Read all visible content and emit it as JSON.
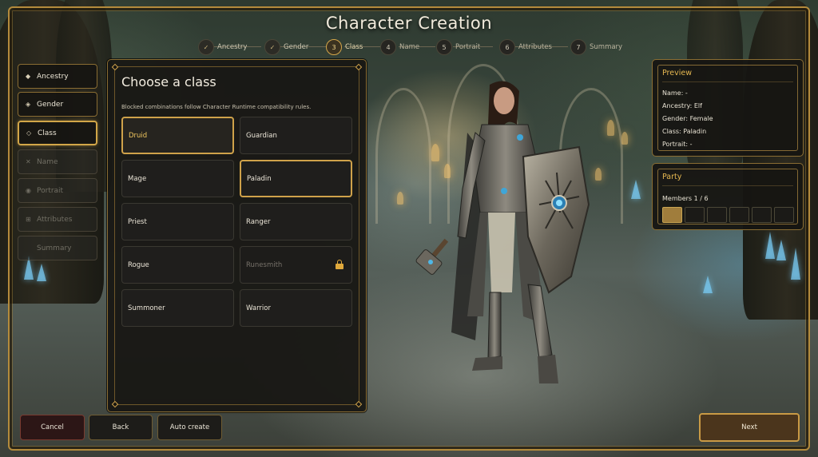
{
  "title": "Character Creation",
  "stepper": [
    {
      "num": "✓",
      "label": "Ancestry",
      "state": "done"
    },
    {
      "num": "✓",
      "label": "Gender",
      "state": "done"
    },
    {
      "num": "3",
      "label": "Class",
      "state": "current"
    },
    {
      "num": "4",
      "label": "Name",
      "state": "pending"
    },
    {
      "num": "5",
      "label": "Portrait",
      "state": "pending"
    },
    {
      "num": "6",
      "label": "Attributes",
      "state": "pending"
    },
    {
      "num": "7",
      "label": "Summary",
      "state": "pending"
    }
  ],
  "sidebar": {
    "items": [
      {
        "label": "Ancestry",
        "icon": "◆",
        "state": "done"
      },
      {
        "label": "Gender",
        "icon": "◈",
        "state": "done"
      },
      {
        "label": "Class",
        "icon": "◇",
        "state": "active"
      },
      {
        "label": "Name",
        "icon": "✕",
        "state": "locked"
      },
      {
        "label": "Portrait",
        "icon": "◉",
        "state": "locked"
      },
      {
        "label": "Attributes",
        "icon": "⊞",
        "state": "locked"
      },
      {
        "label": "Summary",
        "icon": "",
        "state": "locked"
      }
    ]
  },
  "class_panel": {
    "title": "Choose a class",
    "subtitle": "Blocked combinations follow Character Runtime compatibility rules.",
    "classes": [
      {
        "label": "Druid",
        "state": "selected"
      },
      {
        "label": "Guardian",
        "state": "normal"
      },
      {
        "label": "Mage",
        "state": "normal"
      },
      {
        "label": "Paladin",
        "state": "chosen"
      },
      {
        "label": "Priest",
        "state": "normal"
      },
      {
        "label": "Ranger",
        "state": "normal"
      },
      {
        "label": "Rogue",
        "state": "normal"
      },
      {
        "label": "Runesmith",
        "state": "locked"
      },
      {
        "label": "Summoner",
        "state": "normal"
      },
      {
        "label": "Warrior",
        "state": "normal"
      }
    ]
  },
  "preview": {
    "title": "Preview",
    "name": "Name: -",
    "ancestry": "Ancestry: Elf",
    "gender": "Gender: Female",
    "class": "Class: Paladin",
    "portrait": "Portrait: -"
  },
  "party": {
    "title": "Party",
    "members": "Members 1 / 6",
    "slots_filled": 1,
    "slots_total": 6
  },
  "buttons": {
    "cancel": "Cancel",
    "back": "Back",
    "auto": "Auto create",
    "next": "Next"
  },
  "colors": {
    "accent_gold": "#cfa24a",
    "panel_bg": "#181714",
    "locked_icon": "#e0a93c"
  }
}
